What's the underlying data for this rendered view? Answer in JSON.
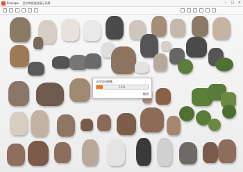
{
  "window": {
    "app_name": "Enscape",
    "title": "室内陶瓷器皿展示场景",
    "min_label": "–",
    "max_label": "□",
    "close_label": "✕"
  },
  "toolbar": {
    "icons": [
      "select-icon",
      "move-icon",
      "rotate-icon",
      "scale-icon",
      "camera-icon",
      "light-icon",
      "material-icon",
      "render-icon",
      "settings-icon",
      "grid-icon",
      "view-icon",
      "export-icon"
    ]
  },
  "dialog": {
    "title": "正在导出图像...",
    "progress_percent": 12,
    "progress_label": "12%",
    "cancel_label": "取消"
  },
  "colors": {
    "progress": "#f07a1a",
    "background": "#f2f2f2"
  }
}
